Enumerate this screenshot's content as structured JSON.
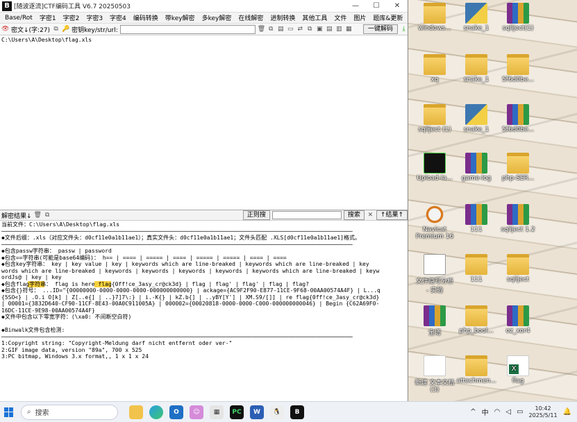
{
  "app": {
    "title": "[随波逐流]CTF编码工具 V6.7  20250503",
    "logo": "B"
  },
  "menu": [
    "Base/Rot",
    "字密1",
    "字密2",
    "字密3",
    "字密4",
    "编码转换",
    "带key解密",
    "多key解密",
    "在线解密",
    "进制转换",
    "其他工具",
    "文件",
    "图片",
    "题库&更新"
  ],
  "toolbar": {
    "cipher_label": "密文↓(字:27)",
    "key_label": "密钥key/str/url:",
    "key_value": "",
    "one_click": "一键解码"
  },
  "editor": {
    "text": "C:\\Users\\A\\Desktop\\flag.xls"
  },
  "results_bar": {
    "label": "解密结果↓",
    "regex_btn": "正则搜",
    "search_btn": "搜索",
    "result_btn": "↑结果↑"
  },
  "results": {
    "current_file": "当前文件：C:\\Users\\A\\Desktop\\flag.xls",
    "sep": "─────────────────────────────────────────────────────────────────────────────────────────────────────────",
    "suffix": "◆文件后缀：.xls（对应文件头：d0cf11e0a1b11ae1）；真实文件头：d0cf11e0a1b11ae1；文件头匹配 .XLS[d0cf11e0a1b11ae1]格式。",
    "l1": "◆包含passw字符串： passw | password",
    "l2": "◆包含==字符串(可能是base64编码)： h== | ==== | ===== | ==== | ===== | ===== | ==== | ====",
    "l3": "◆包含key字符串： key | key value | key | keywords which are line-breaked | keywords which are line-breaked | key",
    "l3b": "words which are line-breaked | keywords | keywords | keywords | keywords | keywords which are line-breaked | keyw",
    "l3c": "ordJs@ | key | key",
    "l4": "◆包含flag字符串： flag is here flag{0ff!ce_3asy_cr@ck3d} | flag | flag' | flag' | flag | flag?",
    "l5": "◆包含{}符号： ...ID=\"{00000000-0000-0000-0000-000000000000} | ackage={AC9F2F90-E877-11CE-9F68-00AA00574A4F} | L...q",
    "l5b": "{5SO<} | .O.i O[k] | Z[..e{] | ..}7]7\\:} | i.-K{} | kZ.b{] | ..yBY[Y'] | XM.S9/[]] | re flag{0ff!ce_3asy_cr@ck3d}",
    "l5c": "| 00001={3832D640-CF90-11CF-8E43-00A0C911005A} | 000002={00020818-0000-0000-C000-000000000046} | Begin {C62A69F0-",
    "l5d": "16DC-11CE-9E98-00AA00574A4F}",
    "l6": "◆文件中包含以下零宽字符：(\\xa0: 不间断空白符)",
    "binwalk": "◆Binwalk文件包含检测:",
    "b1": "1:Copyright string: \"Copyright-Meldung darf nicht entfernt oder ver-\"",
    "b2": "2:GIF image data, version \"89a\", 700 x 525",
    "b3": "3:PC bitmap, Windows 3.x format,, 1 x 1 x 24"
  },
  "desktop": [
    {
      "label": "windows...",
      "icon": "folder"
    },
    {
      "label": "snake_1",
      "icon": "py"
    },
    {
      "label": "sqliject(1)",
      "icon": "rar"
    },
    {
      "label": "xq",
      "icon": "folder"
    },
    {
      "label": "snake_1",
      "icon": "folder"
    },
    {
      "label": "5f6d0be...",
      "icon": "folder"
    },
    {
      "label": "sqliject (1)",
      "icon": "folder"
    },
    {
      "label": "snake_1",
      "icon": "py"
    },
    {
      "label": "5f6d0be...",
      "icon": "rar"
    },
    {
      "label": "Upload-la...",
      "icon": "ctf"
    },
    {
      "label": "game-log",
      "icon": "rar"
    },
    {
      "label": "php-SER...",
      "icon": "folder"
    },
    {
      "label": "Navicat Premium 16",
      "icon": "navicat"
    },
    {
      "label": "111",
      "icon": "rar"
    },
    {
      "label": "sqliject 1.2",
      "icon": "rar"
    },
    {
      "label": "文件隐写分析 - 实验",
      "icon": "doc"
    },
    {
      "label": "111",
      "icon": "folder"
    },
    {
      "label": "sqliject",
      "icon": "folder"
    },
    {
      "label": "宝塔",
      "icon": "rar"
    },
    {
      "label": "php_bool...",
      "icon": "folder"
    },
    {
      "label": "oz_xor4",
      "icon": "rar"
    },
    {
      "label": "新建 文本文档 (3)",
      "icon": "txt"
    },
    {
      "label": "attachmen...",
      "icon": "folder"
    },
    {
      "label": "flag",
      "icon": "xls"
    }
  ],
  "taskbar": {
    "search": "搜索",
    "ime": "中",
    "time": "10:42",
    "date": "2025/5/11"
  }
}
